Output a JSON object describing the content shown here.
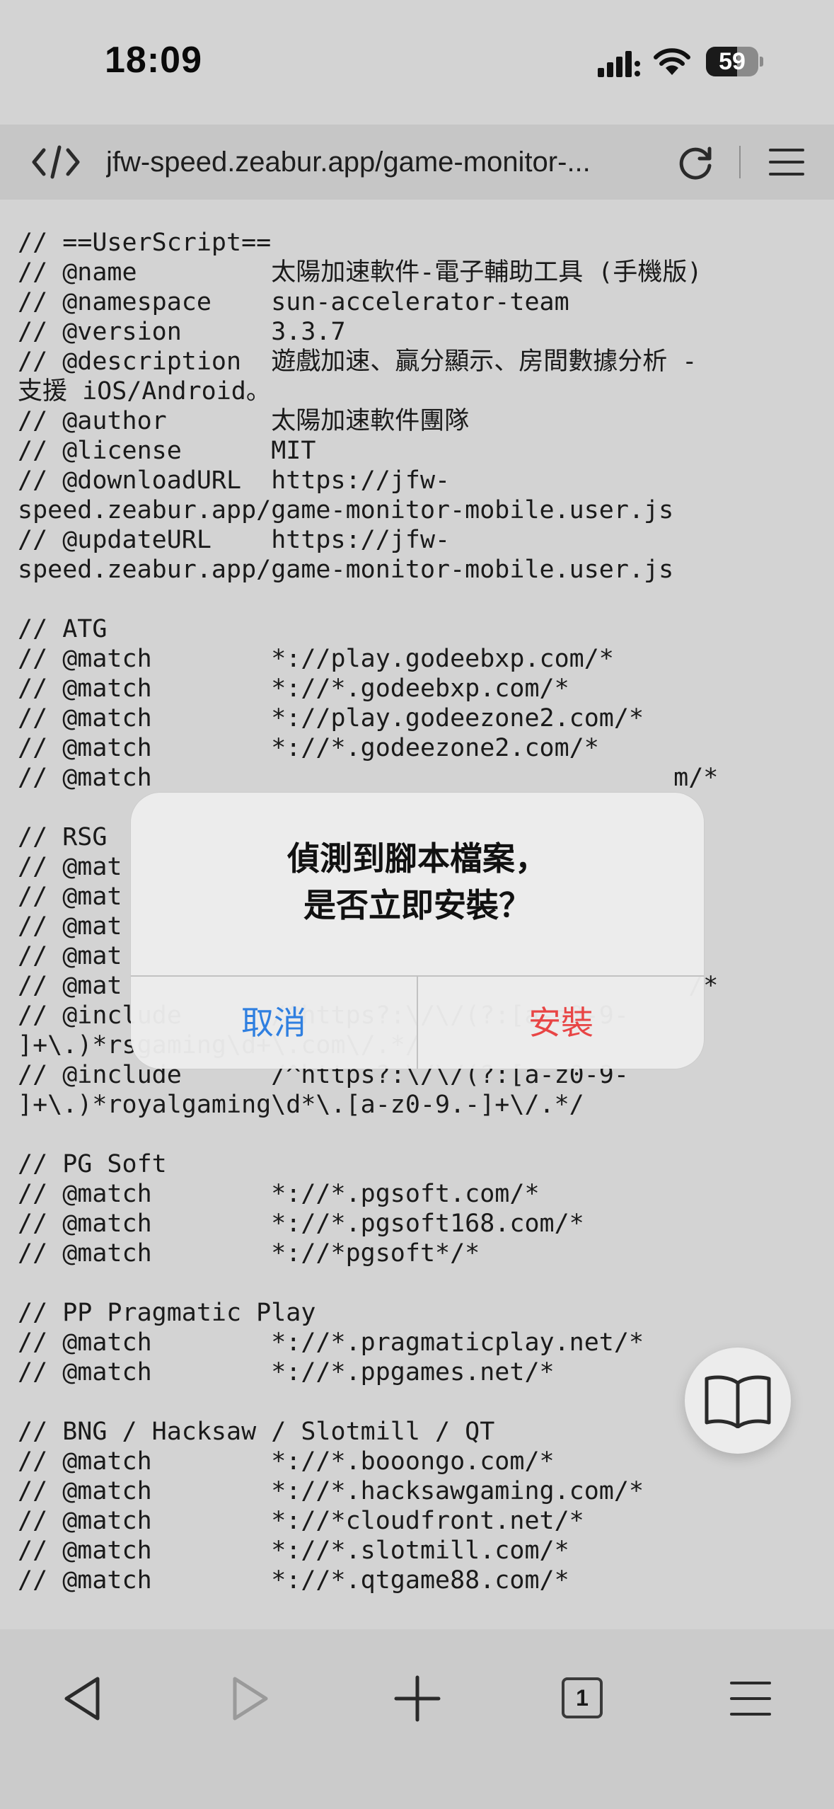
{
  "status_bar": {
    "time": "18:09",
    "battery_level": "59",
    "battery_fraction": 0.59
  },
  "address_bar": {
    "url": "jfw-speed.zeabur.app/game-monitor-..."
  },
  "code_lines": [
    "// ==UserScript==",
    "// @name         太陽加速軟件-電子輔助工具 (手機版)",
    "// @namespace    sun-accelerator-team",
    "// @version      3.3.7",
    "// @description  遊戲加速、贏分顯示、房間數據分析 -",
    "支援 iOS/Android。",
    "// @author       太陽加速軟件團隊",
    "// @license      MIT",
    "// @downloadURL  https://jfw-",
    "speed.zeabur.app/game-monitor-mobile.user.js",
    "// @updateURL    https://jfw-",
    "speed.zeabur.app/game-monitor-mobile.user.js",
    "",
    "// ATG",
    "// @match        *://play.godeebxp.com/*",
    "// @match        *://*.godeebxp.com/*",
    "// @match        *://play.godeezone2.com/*",
    "// @match        *://*.godeezone2.com/*",
    "// @match                                   m/*",
    "",
    "// RSG",
    "// @mat",
    "// @mat",
    "// @mat",
    "// @mat",
    "// @mat                                      /*",
    "// @include      /^https?:\\/\\/(?:[a-z0-9-",
    "]+\\.)*rsgaming\\d+\\.com\\/.*/",
    "// @include      /^https?:\\/\\/(?:[a-z0-9-",
    "]+\\.)*royalgaming\\d*\\.[a-z0-9.-]+\\/.*/",
    "",
    "// PG Soft",
    "// @match        *://*.pgsoft.com/*",
    "// @match        *://*.pgsoft168.com/*",
    "// @match        *://*pgsoft*/*",
    "",
    "// PP Pragmatic Play",
    "// @match        *://*.pragmaticplay.net/*",
    "// @match        *://*.ppgames.net/*",
    "",
    "// BNG / Hacksaw / Slotmill / QT",
    "// @match        *://*.booongo.com/*",
    "// @match        *://*.hacksawgaming.com/*",
    "// @match        *://*cloudfront.net/*",
    "// @match        *://*.slotmill.com/*",
    "// @match        *://*.qtgame88.com/*"
  ],
  "dialog": {
    "title": "偵測到腳本檔案，\n是否立即安裝？",
    "cancel_label": "取消",
    "install_label": "安裝"
  },
  "toolbar": {
    "tab_count": "1"
  },
  "colors": {
    "cancel": "#2f7fe0",
    "install": "#e84545",
    "background": "#d3d3d3"
  }
}
